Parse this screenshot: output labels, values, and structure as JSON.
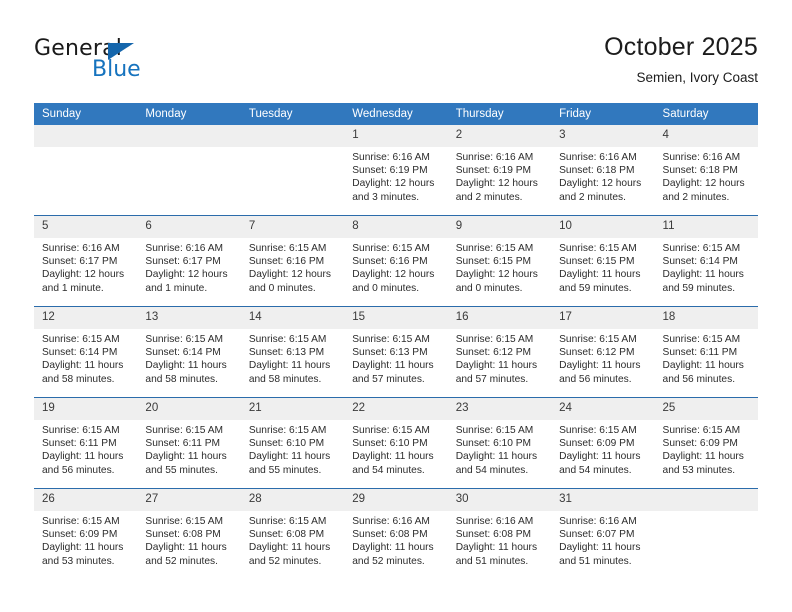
{
  "brand": {
    "name_part1": "General",
    "name_part2": "Blue",
    "logo_icon": "triangle-logo-icon"
  },
  "header": {
    "title": "October 2025",
    "subtitle": "Semien, Ivory Coast"
  },
  "colors": {
    "header_blue": "#3178be",
    "row_separator": "#2b6cab",
    "daynum_band": "#efefef",
    "brand_blue": "#1673be"
  },
  "weekday_headers": [
    "Sunday",
    "Monday",
    "Tuesday",
    "Wednesday",
    "Thursday",
    "Friday",
    "Saturday"
  ],
  "weeks": [
    [
      {
        "day": "",
        "sunrise": "",
        "sunset": "",
        "daylight": ""
      },
      {
        "day": "",
        "sunrise": "",
        "sunset": "",
        "daylight": ""
      },
      {
        "day": "",
        "sunrise": "",
        "sunset": "",
        "daylight": ""
      },
      {
        "day": "1",
        "sunrise": "Sunrise: 6:16 AM",
        "sunset": "Sunset: 6:19 PM",
        "daylight": "Daylight: 12 hours and 3 minutes."
      },
      {
        "day": "2",
        "sunrise": "Sunrise: 6:16 AM",
        "sunset": "Sunset: 6:19 PM",
        "daylight": "Daylight: 12 hours and 2 minutes."
      },
      {
        "day": "3",
        "sunrise": "Sunrise: 6:16 AM",
        "sunset": "Sunset: 6:18 PM",
        "daylight": "Daylight: 12 hours and 2 minutes."
      },
      {
        "day": "4",
        "sunrise": "Sunrise: 6:16 AM",
        "sunset": "Sunset: 6:18 PM",
        "daylight": "Daylight: 12 hours and 2 minutes."
      }
    ],
    [
      {
        "day": "5",
        "sunrise": "Sunrise: 6:16 AM",
        "sunset": "Sunset: 6:17 PM",
        "daylight": "Daylight: 12 hours and 1 minute."
      },
      {
        "day": "6",
        "sunrise": "Sunrise: 6:16 AM",
        "sunset": "Sunset: 6:17 PM",
        "daylight": "Daylight: 12 hours and 1 minute."
      },
      {
        "day": "7",
        "sunrise": "Sunrise: 6:15 AM",
        "sunset": "Sunset: 6:16 PM",
        "daylight": "Daylight: 12 hours and 0 minutes."
      },
      {
        "day": "8",
        "sunrise": "Sunrise: 6:15 AM",
        "sunset": "Sunset: 6:16 PM",
        "daylight": "Daylight: 12 hours and 0 minutes."
      },
      {
        "day": "9",
        "sunrise": "Sunrise: 6:15 AM",
        "sunset": "Sunset: 6:15 PM",
        "daylight": "Daylight: 12 hours and 0 minutes."
      },
      {
        "day": "10",
        "sunrise": "Sunrise: 6:15 AM",
        "sunset": "Sunset: 6:15 PM",
        "daylight": "Daylight: 11 hours and 59 minutes."
      },
      {
        "day": "11",
        "sunrise": "Sunrise: 6:15 AM",
        "sunset": "Sunset: 6:14 PM",
        "daylight": "Daylight: 11 hours and 59 minutes."
      }
    ],
    [
      {
        "day": "12",
        "sunrise": "Sunrise: 6:15 AM",
        "sunset": "Sunset: 6:14 PM",
        "daylight": "Daylight: 11 hours and 58 minutes."
      },
      {
        "day": "13",
        "sunrise": "Sunrise: 6:15 AM",
        "sunset": "Sunset: 6:14 PM",
        "daylight": "Daylight: 11 hours and 58 minutes."
      },
      {
        "day": "14",
        "sunrise": "Sunrise: 6:15 AM",
        "sunset": "Sunset: 6:13 PM",
        "daylight": "Daylight: 11 hours and 58 minutes."
      },
      {
        "day": "15",
        "sunrise": "Sunrise: 6:15 AM",
        "sunset": "Sunset: 6:13 PM",
        "daylight": "Daylight: 11 hours and 57 minutes."
      },
      {
        "day": "16",
        "sunrise": "Sunrise: 6:15 AM",
        "sunset": "Sunset: 6:12 PM",
        "daylight": "Daylight: 11 hours and 57 minutes."
      },
      {
        "day": "17",
        "sunrise": "Sunrise: 6:15 AM",
        "sunset": "Sunset: 6:12 PM",
        "daylight": "Daylight: 11 hours and 56 minutes."
      },
      {
        "day": "18",
        "sunrise": "Sunrise: 6:15 AM",
        "sunset": "Sunset: 6:11 PM",
        "daylight": "Daylight: 11 hours and 56 minutes."
      }
    ],
    [
      {
        "day": "19",
        "sunrise": "Sunrise: 6:15 AM",
        "sunset": "Sunset: 6:11 PM",
        "daylight": "Daylight: 11 hours and 56 minutes."
      },
      {
        "day": "20",
        "sunrise": "Sunrise: 6:15 AM",
        "sunset": "Sunset: 6:11 PM",
        "daylight": "Daylight: 11 hours and 55 minutes."
      },
      {
        "day": "21",
        "sunrise": "Sunrise: 6:15 AM",
        "sunset": "Sunset: 6:10 PM",
        "daylight": "Daylight: 11 hours and 55 minutes."
      },
      {
        "day": "22",
        "sunrise": "Sunrise: 6:15 AM",
        "sunset": "Sunset: 6:10 PM",
        "daylight": "Daylight: 11 hours and 54 minutes."
      },
      {
        "day": "23",
        "sunrise": "Sunrise: 6:15 AM",
        "sunset": "Sunset: 6:10 PM",
        "daylight": "Daylight: 11 hours and 54 minutes."
      },
      {
        "day": "24",
        "sunrise": "Sunrise: 6:15 AM",
        "sunset": "Sunset: 6:09 PM",
        "daylight": "Daylight: 11 hours and 54 minutes."
      },
      {
        "day": "25",
        "sunrise": "Sunrise: 6:15 AM",
        "sunset": "Sunset: 6:09 PM",
        "daylight": "Daylight: 11 hours and 53 minutes."
      }
    ],
    [
      {
        "day": "26",
        "sunrise": "Sunrise: 6:15 AM",
        "sunset": "Sunset: 6:09 PM",
        "daylight": "Daylight: 11 hours and 53 minutes."
      },
      {
        "day": "27",
        "sunrise": "Sunrise: 6:15 AM",
        "sunset": "Sunset: 6:08 PM",
        "daylight": "Daylight: 11 hours and 52 minutes."
      },
      {
        "day": "28",
        "sunrise": "Sunrise: 6:15 AM",
        "sunset": "Sunset: 6:08 PM",
        "daylight": "Daylight: 11 hours and 52 minutes."
      },
      {
        "day": "29",
        "sunrise": "Sunrise: 6:16 AM",
        "sunset": "Sunset: 6:08 PM",
        "daylight": "Daylight: 11 hours and 52 minutes."
      },
      {
        "day": "30",
        "sunrise": "Sunrise: 6:16 AM",
        "sunset": "Sunset: 6:08 PM",
        "daylight": "Daylight: 11 hours and 51 minutes."
      },
      {
        "day": "31",
        "sunrise": "Sunrise: 6:16 AM",
        "sunset": "Sunset: 6:07 PM",
        "daylight": "Daylight: 11 hours and 51 minutes."
      },
      {
        "day": "",
        "sunrise": "",
        "sunset": "",
        "daylight": ""
      }
    ]
  ]
}
